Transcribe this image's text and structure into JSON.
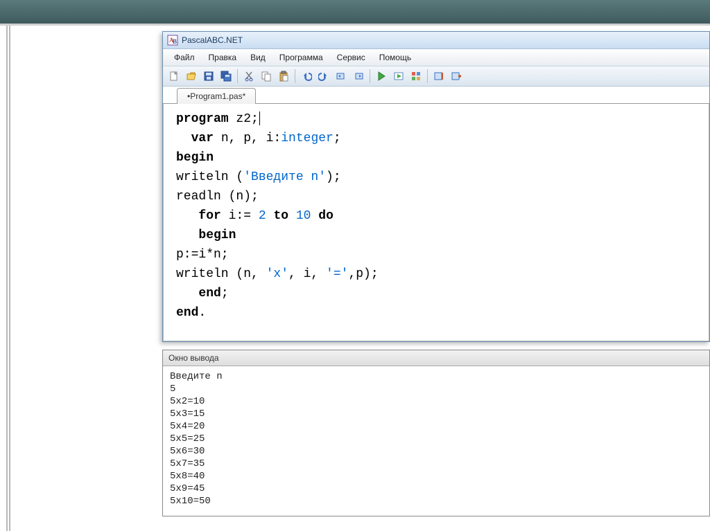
{
  "app": {
    "title": "PascalABC.NET"
  },
  "menu": {
    "file": "Файл",
    "edit": "Правка",
    "view": "Вид",
    "program": "Программа",
    "service": "Сервис",
    "help": "Помощь"
  },
  "tab": {
    "label": "•Program1.pas*"
  },
  "code": {
    "l1_kw": "program",
    "l1_name": " z2;",
    "l2_kw": "var",
    "l2_rest": " n, p, i:",
    "l2_type": "integer",
    "l2_semi": ";",
    "l3_kw": "begin",
    "l4_a": "   writeln (",
    "l4_str": "'Введите n'",
    "l4_b": ");",
    "l5": "   readln (n);",
    "l6_kw1": "for",
    "l6_a": " i:= ",
    "l6_n1": "2",
    "l6_b": " ",
    "l6_kw2": "to",
    "l6_c": " ",
    "l6_n2": "10",
    "l6_d": " ",
    "l6_kw3": "do",
    "l7_kw": "begin",
    "l8": "     p:=i*n;",
    "l9_a": "     writeln (n, ",
    "l9_s1": "'x'",
    "l9_b": ", i, ",
    "l9_s2": "'='",
    "l9_c": ",p);",
    "l10_kw": "end",
    "l10_semi": ";",
    "l11_kw": "end",
    "l11_dot": "."
  },
  "output": {
    "header": "Окно вывода",
    "lines": [
      "Введите n",
      "5",
      "5x2=10",
      "5x3=15",
      "5x4=20",
      "5x5=25",
      "5x6=30",
      "5x7=35",
      "5x8=40",
      "5x9=45",
      "5x10=50"
    ]
  }
}
